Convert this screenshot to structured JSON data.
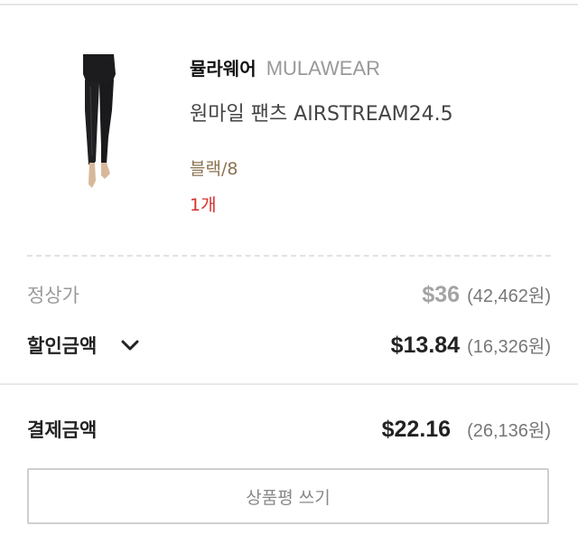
{
  "order_item": {
    "brand_korean": "뮬라웨어",
    "brand_english": "MULAWEAR",
    "product_name": "원마일 팬츠 AIRSTREAM24.5",
    "option": "블랙/8",
    "quantity": "1개"
  },
  "pricing": {
    "regular_label": "정상가",
    "regular_usd": "$36",
    "regular_krw": "(42,462원)",
    "discount_label": "할인금액",
    "discount_usd": "$13.84",
    "discount_krw": "(16,326원)"
  },
  "payment": {
    "total_label": "결제금액",
    "total_usd": "$22.16",
    "total_krw": "(26,136원)"
  },
  "actions": {
    "write_review_label": "상품평 쓰기"
  },
  "icons": {
    "discount_toggle": "chevron-down-icon"
  },
  "colors": {
    "quantity": "#d3312c",
    "option": "#8a7350",
    "brand_english": "#999999"
  }
}
